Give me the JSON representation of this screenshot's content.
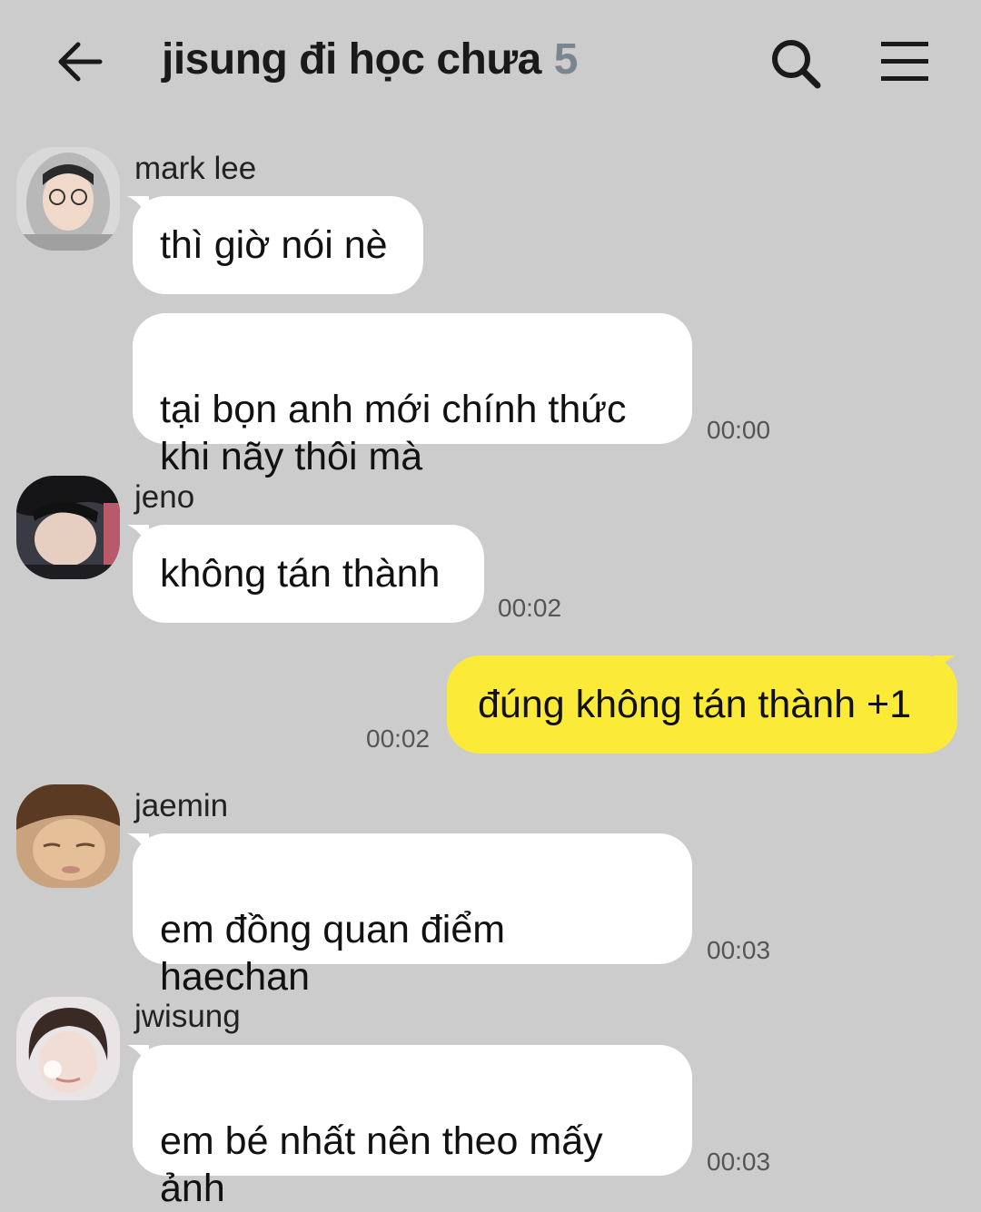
{
  "header": {
    "title": "jisung đi học chưa",
    "member_count": "5"
  },
  "messages": [
    {
      "sender": "mark lee",
      "bubbles": [
        "thì giờ nói nè",
        "tại bọn anh mới chính thức\nkhi nãy thôi mà"
      ],
      "time": "00:00"
    },
    {
      "sender": "jeno",
      "bubbles": [
        "không tán thành"
      ],
      "time": "00:02"
    },
    {
      "sender": "me",
      "bubbles": [
        "đúng không tán thành +1"
      ],
      "time": "00:02"
    },
    {
      "sender": "jaemin",
      "bubbles": [
        "em đồng quan điểm\nhaechan"
      ],
      "time": "00:03"
    },
    {
      "sender": "jwisung",
      "bubbles": [
        "em bé nhất nên theo mấy\nảnh"
      ],
      "time": "00:03"
    }
  ],
  "colors": {
    "background": "#cccccc",
    "bubble_other": "#ffffff",
    "bubble_mine": "#fbea37",
    "member_count": "#7b8590"
  }
}
